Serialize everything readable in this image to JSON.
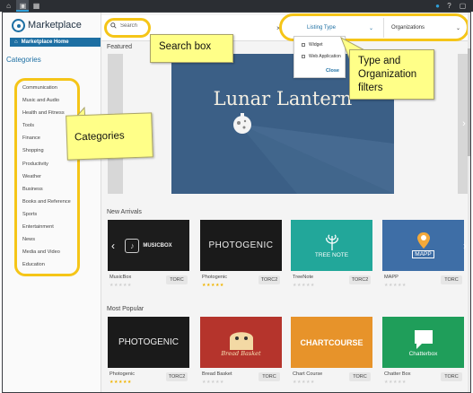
{
  "titlebar": {
    "icons": [
      "home-icon",
      "bag-icon",
      "dashboard-icon",
      "bell-icon",
      "help-icon",
      "window-icon"
    ]
  },
  "sidebar": {
    "logo_text": "Marketplace",
    "home_button": "Marketplace Home",
    "categories_title": "Categories",
    "categories": [
      "Communication",
      "Music and Audio",
      "Health and Fitness",
      "Tools",
      "Finance",
      "Shopping",
      "Productivity",
      "Weather",
      "Business",
      "Books and Reference",
      "Sports",
      "Entertainment",
      "News",
      "Media and Video",
      "Education"
    ]
  },
  "search": {
    "placeholder": "Search",
    "clear_icon": "close-icon"
  },
  "filters": {
    "listing_type": "Listing Type",
    "organizations": "Organizations",
    "options": [
      "Widget",
      "Web Application"
    ],
    "close_label": "Close"
  },
  "sections": {
    "featured": "Featured",
    "new_arrivals": "New Arrivals",
    "most_popular": "Most Popular"
  },
  "featured_banner": {
    "title": "Lunar Lantern",
    "bg_color": "#3b5f86"
  },
  "new_arrivals": [
    {
      "name": "MusicBox",
      "org": "TORC",
      "rating": 0,
      "logo": "MUSICBOX",
      "color": "#1c1c1c"
    },
    {
      "name": "Photogenic",
      "org": "TORC2",
      "rating": 5,
      "logo": "PHOTOGENIC",
      "color": "#1a1a1a"
    },
    {
      "name": "TreeNote",
      "org": "TORC2",
      "rating": 0,
      "logo": "TREE NOTE",
      "color": "#22a79a"
    },
    {
      "name": "MAPP",
      "org": "TORC",
      "rating": 0,
      "logo": "MAPP",
      "color": "#3e6ea6"
    }
  ],
  "most_popular": [
    {
      "name": "Photogenic",
      "org": "TORC2",
      "rating": 5,
      "logo": "PHOTOGENIC",
      "color": "#1a1a1a"
    },
    {
      "name": "Bread Basket",
      "org": "TORC",
      "rating": 0,
      "logo": "Bread Basket",
      "color": "#b5342c"
    },
    {
      "name": "Chart Course",
      "org": "TORC",
      "rating": 0,
      "logo": "CHARTCOURSE",
      "color": "#e7932a"
    },
    {
      "name": "Chatter Box",
      "org": "TORC",
      "rating": 0,
      "logo": "Chatterbox",
      "color": "#1f9e5a"
    }
  ],
  "callouts": {
    "search": "Search box",
    "filters_line1": "Type and",
    "filters_line2": "Organization",
    "filters_line3": "filters",
    "categories": "Categories"
  },
  "colors": {
    "accent": "#1d6fa3",
    "highlight": "#f5c518",
    "callout": "#ffff88",
    "star_filled": "#f0b400",
    "star_empty": "#cfcfcf"
  }
}
